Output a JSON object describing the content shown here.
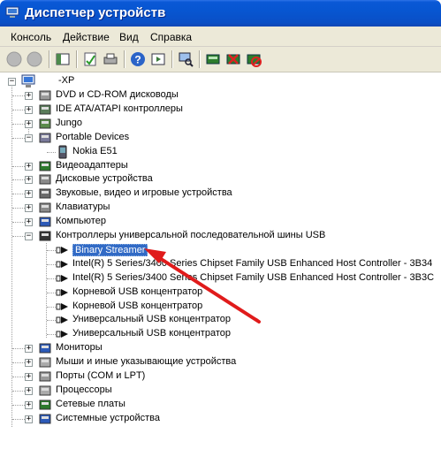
{
  "window": {
    "title": "Диспетчер устройств"
  },
  "menu": [
    "Консоль",
    "Действие",
    "Вид",
    "Справка"
  ],
  "toolbar": {
    "buttons": [
      "back",
      "forward",
      "properties",
      "refresh",
      "print",
      "help",
      "show-hide-console-tree",
      "scan-hardware",
      "update-driver",
      "uninstall",
      "disable"
    ]
  },
  "tree": {
    "root": "-XP",
    "nodes": [
      {
        "label": "DVD и CD-ROM дисководы",
        "icon": "dvd-drive-icon",
        "expander": "+"
      },
      {
        "label": "IDE ATA/ATAPI контроллеры",
        "icon": "ide-controller-icon",
        "expander": "+"
      },
      {
        "label": "Jungo",
        "icon": "jungo-icon",
        "expander": "+"
      },
      {
        "label": "Portable Devices",
        "icon": "portable-devices-icon",
        "expander": "-",
        "children": [
          "Nokia E51"
        ]
      },
      {
        "label": "Видеоадаптеры",
        "icon": "display-adapter-icon",
        "expander": "+"
      },
      {
        "label": "Дисковые устройства",
        "icon": "disk-drive-icon",
        "expander": "+"
      },
      {
        "label": "Звуковые, видео и игровые устройства",
        "icon": "sound-icon",
        "expander": "+"
      },
      {
        "label": "Клавиатуры",
        "icon": "keyboard-icon",
        "expander": "+"
      },
      {
        "label": "Компьютер",
        "icon": "computer-icon",
        "expander": "+"
      },
      {
        "label": "Контроллеры универсальной последовательной шины USB",
        "icon": "usb-controller-icon",
        "expander": "-",
        "children": [
          "Binary Streamer",
          "Intel(R) 5 Series/3400 Series Chipset Family USB Enhanced Host Controller - 3B34",
          "Intel(R) 5 Series/3400 Series Chipset Family USB Enhanced Host Controller - 3B3C",
          "Корневой USB концентратор",
          "Корневой USB концентратор",
          "Универсальный USB концентратор",
          "Универсальный USB концентратор"
        ]
      },
      {
        "label": "Мониторы",
        "icon": "monitor-icon",
        "expander": "+"
      },
      {
        "label": "Мыши и иные указывающие устройства",
        "icon": "mouse-icon",
        "expander": "+"
      },
      {
        "label": "Порты (COM и LPT)",
        "icon": "port-icon",
        "expander": "+"
      },
      {
        "label": "Процессоры",
        "icon": "processor-icon",
        "expander": "+"
      },
      {
        "label": "Сетевые платы",
        "icon": "network-adapter-icon",
        "expander": "+"
      },
      {
        "label": "Системные устройства",
        "icon": "system-device-icon",
        "expander": "+"
      }
    ],
    "selected": "Binary Streamer"
  },
  "colors": {
    "title_bar": "#0a58d6",
    "selection": "#316ac5",
    "annotation_arrow": "#e01b1b",
    "chrome": "#ece9d8"
  }
}
